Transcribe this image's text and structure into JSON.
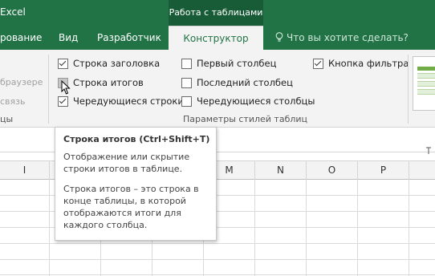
{
  "window": {
    "app_title": "Excel",
    "context_tab_group": "Работа с таблицами"
  },
  "tabs": [
    {
      "label": "рование"
    },
    {
      "label": "Вид"
    },
    {
      "label": "Разработчик"
    },
    {
      "label": "Конструктор",
      "active": true
    }
  ],
  "tell_me": "Что вы хотите сделать?",
  "ribbon": {
    "left_cut": {
      "item1": "браузере",
      "item2": "связь",
      "group_label": "цы"
    },
    "style_options": {
      "group_label": "Параметры стилей таблиц",
      "checkboxes": [
        {
          "label": "Строка заголовка",
          "checked": true
        },
        {
          "label": "Строка итогов",
          "checked": false
        },
        {
          "label": "Чередующиеся строки",
          "checked": true
        },
        {
          "label": "Первый столбец",
          "checked": false
        },
        {
          "label": "Последний столбец",
          "checked": false
        },
        {
          "label": "Чередующиеся столбцы",
          "checked": false
        },
        {
          "label": "Кнопка фильтра",
          "checked": true
        }
      ]
    }
  },
  "columns": [
    "I",
    "",
    "",
    "",
    "M",
    "N",
    "O",
    "P"
  ],
  "tooltip": {
    "title": "Строка итогов (Ctrl+Shift+T)",
    "paragraph1": "Отображение или скрытие строки итогов в таблице.",
    "paragraph2": "Строка итогов – это строка в конце таблицы, в которой отображаются итоги для каждого столбца."
  },
  "colors": {
    "excel_green": "#217346",
    "context_green": "#185c37",
    "ribbon_bg": "#f3f3f3"
  }
}
